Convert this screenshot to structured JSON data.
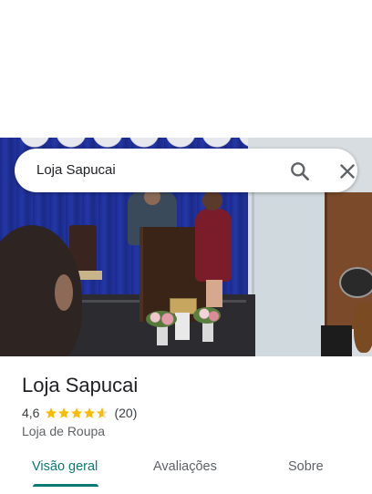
{
  "search": {
    "query": "Loja Sapucai",
    "search_icon": "search-icon",
    "close_icon": "close-icon"
  },
  "photo": {
    "description_icon": "place-photo"
  },
  "place": {
    "name": "Loja Sapucai",
    "rating": "4,6",
    "stars": 4.6,
    "review_count": "(20)",
    "category": "Loja de Roupa"
  },
  "tabs": [
    {
      "label": "Visão geral",
      "active": true
    },
    {
      "label": "Avaliações",
      "active": false
    },
    {
      "label": "Sobre",
      "active": false
    }
  ],
  "colors": {
    "accent": "#0b7a74",
    "star": "#fbbc04",
    "text_primary": "#202124",
    "text_secondary": "#5f6368"
  }
}
